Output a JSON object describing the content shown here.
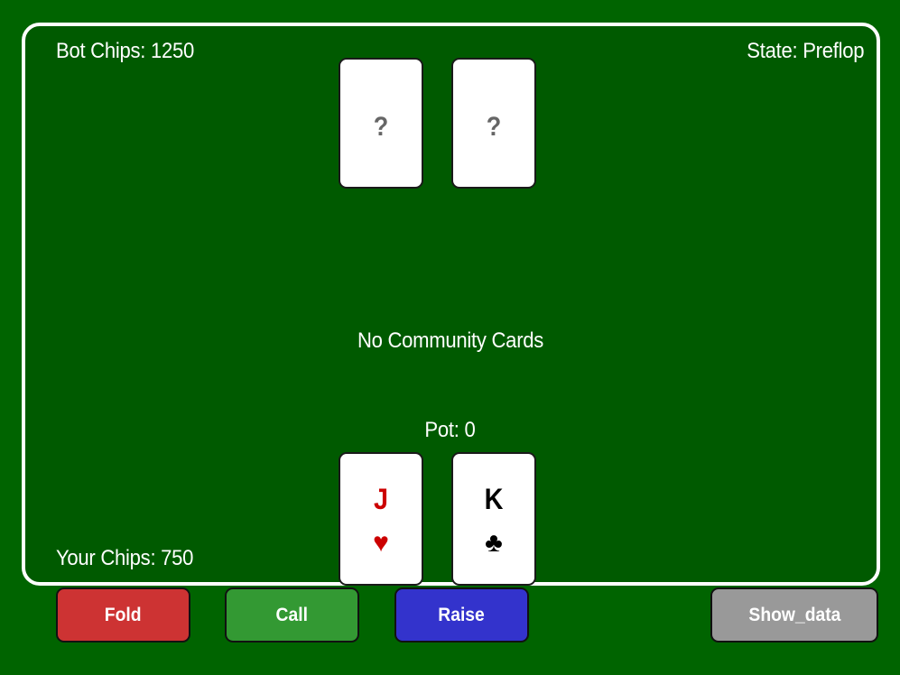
{
  "bot": {
    "chips_label": "Bot Chips: 1250",
    "hidden_cards": [
      "?",
      "?"
    ]
  },
  "game": {
    "state_label": "State: Preflop",
    "community_label": "No Community Cards",
    "pot_label": "Pot: 0"
  },
  "player": {
    "chips_label": "Your Chips: 750",
    "cards": [
      {
        "rank": "J",
        "suit": "♥",
        "color": "#cc0000"
      },
      {
        "rank": "K",
        "suit": "♣",
        "color": "#000000"
      }
    ]
  },
  "buttons": {
    "fold": "Fold",
    "call": "Call",
    "raise": "Raise",
    "show_data": "Show_data"
  },
  "colors": {
    "background": "#006400",
    "table": "#005a00",
    "fold": "#cd3333",
    "call": "#339933",
    "raise": "#3333cc",
    "show_data": "#999999"
  }
}
